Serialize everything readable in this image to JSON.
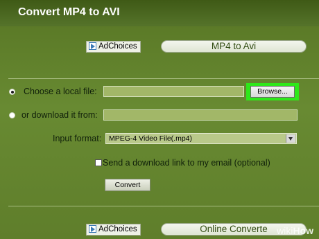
{
  "header": {
    "title": "Convert MP4 to AVI"
  },
  "ads": {
    "top": {
      "label": "AdChoices",
      "pill": "MP4 to Avi"
    },
    "bottom": {
      "label": "AdChoices",
      "pill": "Online Converte"
    }
  },
  "form": {
    "local_file_label": "Choose a local file:",
    "local_file_value": "",
    "browse_label": "Browse...",
    "download_label": "or download it from:",
    "download_url_value": "",
    "input_format_label": "Input format:",
    "input_format_value": "MPEG-4 Video File(.mp4)",
    "email_link_label": "Send a download link to my email (optional)",
    "convert_label": "Convert"
  },
  "watermark": {
    "prefix": "wiki",
    "suffix": "How"
  },
  "colors": {
    "page_green": "#5f7e2b",
    "header_green": "#4a6620",
    "highlight": "#2ee81a"
  }
}
